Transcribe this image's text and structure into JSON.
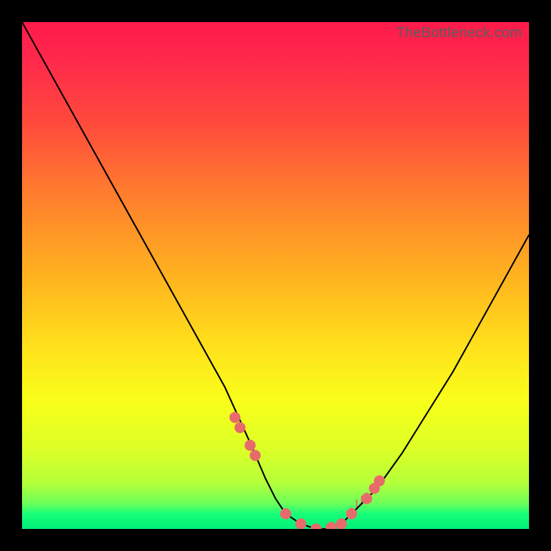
{
  "watermark": "TheBottleneck.com",
  "chart_data": {
    "type": "line",
    "title": "",
    "xlabel": "",
    "ylabel": "",
    "xlim": [
      0,
      100
    ],
    "ylim": [
      0,
      100
    ],
    "grid": false,
    "legend": false,
    "series": [
      {
        "name": "bottleneck-curve",
        "x": [
          0,
          5,
          10,
          15,
          20,
          25,
          30,
          35,
          40,
          45,
          48,
          50,
          52,
          55,
          58,
          60,
          63,
          65,
          70,
          75,
          80,
          85,
          90,
          95,
          100
        ],
        "y": [
          100,
          91,
          82,
          73,
          64,
          55,
          46,
          37,
          28,
          17,
          10,
          6,
          3,
          1,
          0,
          0,
          1,
          3,
          8,
          15,
          23,
          31,
          40,
          49,
          58
        ],
        "color": "#000000"
      }
    ],
    "markers": [
      {
        "name": "highlight-dots",
        "color": "#e86b6b",
        "x": [
          42,
          43,
          45,
          46,
          52,
          55,
          58,
          61,
          63,
          65,
          68,
          69.5,
          70.5
        ],
        "y": [
          22,
          20,
          16.5,
          14.5,
          3,
          1,
          0,
          0.3,
          1,
          3,
          6,
          8,
          9.5
        ]
      }
    ],
    "ticks": {
      "x": [
        65,
        66,
        67,
        68,
        69,
        70
      ],
      "height": [
        1.2,
        1.8,
        1.5,
        1.2,
        1.0,
        1.0
      ]
    }
  }
}
